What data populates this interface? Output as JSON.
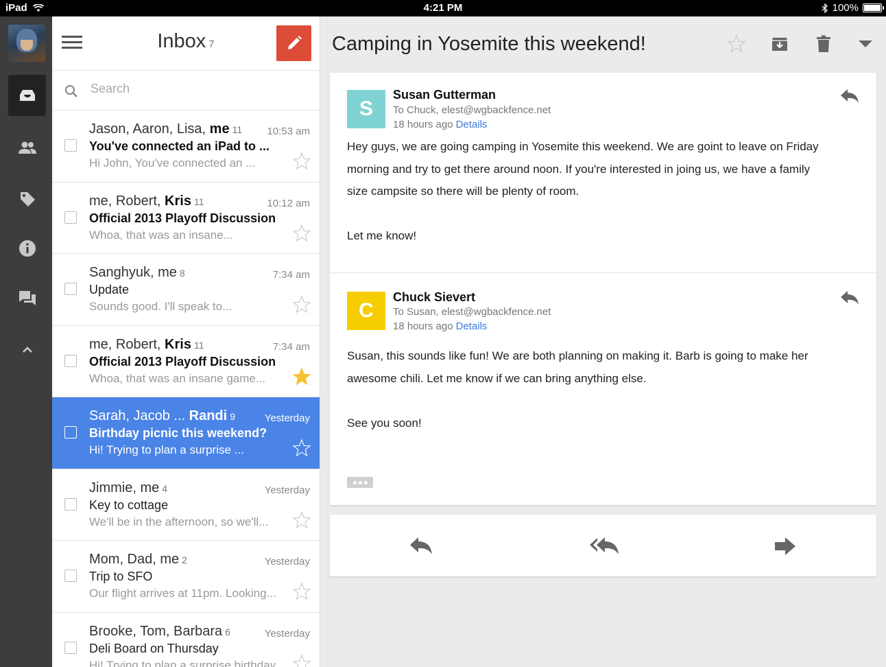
{
  "status_bar": {
    "device": "iPad",
    "time": "4:21 PM",
    "battery": "100%",
    "battery_level": 1.0
  },
  "rail": {
    "items": [
      "inbox-tray-icon",
      "people-icon",
      "label-icon",
      "info-icon",
      "chat-icon",
      "chevron-up-icon"
    ]
  },
  "inbox": {
    "title": "Inbox",
    "unread_count": "7",
    "search_placeholder": "Search",
    "threads": [
      {
        "from_plain": "Jason, Aaron, Lisa, ",
        "from_bold": "me",
        "count": "11",
        "time": "10:53 am",
        "subject": "You've connected an iPad to ...",
        "subject_bold": true,
        "snippet": "Hi John, You've connected an ...",
        "starred": false,
        "selected": false
      },
      {
        "from_plain": "me, Robert, ",
        "from_bold": "Kris",
        "count": "11",
        "time": "10:12 am",
        "subject": "Official 2013 Playoff Discussion",
        "subject_bold": true,
        "snippet": "Whoa, that was an insane...",
        "starred": false,
        "selected": false
      },
      {
        "from_plain": "Sanghyuk, me",
        "from_bold": "",
        "count": "8",
        "time": "7:34 am",
        "subject": "Update",
        "subject_bold": false,
        "snippet": "Sounds good. I'll speak to...",
        "starred": false,
        "selected": false
      },
      {
        "from_plain": "me, Robert, ",
        "from_bold": "Kris",
        "count": "11",
        "time": "7:34 am",
        "subject": "Official 2013 Playoff Discussion",
        "subject_bold": true,
        "snippet": "Whoa, that was an insane game...",
        "starred": true,
        "selected": false
      },
      {
        "from_plain": "Sarah, Jacob ... ",
        "from_bold": "Randi",
        "count": "9",
        "time": "Yesterday",
        "subject": "Birthday picnic this weekend?",
        "subject_bold": true,
        "snippet": "Hi! Trying to plan a surprise ...",
        "starred": false,
        "selected": true
      },
      {
        "from_plain": "Jimmie, me",
        "from_bold": "",
        "count": "4",
        "time": "Yesterday",
        "subject": "Key to cottage",
        "subject_bold": false,
        "snippet": "We'll be in the afternoon, so we'll...",
        "starred": false,
        "selected": false
      },
      {
        "from_plain": "Mom, Dad, me",
        "from_bold": "",
        "count": "2",
        "time": "Yesterday",
        "subject": "Trip to SFO",
        "subject_bold": false,
        "snippet": "Our flight arrives at 11pm. Looking...",
        "starred": false,
        "selected": false
      },
      {
        "from_plain": "Brooke, Tom, Barbara",
        "from_bold": "",
        "count": "6",
        "time": "Yesterday",
        "subject": "Deli Board on Thursday",
        "subject_bold": false,
        "snippet": "Hi! Trying to plan a surprise birthday...",
        "starred": false,
        "selected": false
      }
    ]
  },
  "reader": {
    "thread_title": "Camping in Yosemite this weekend!",
    "messages": [
      {
        "avatar_letter": "S",
        "avatar_color": "#7fd3d3",
        "sender": "Susan Gutterman",
        "to": "To Chuck, elest@wgbackfence.net",
        "time": "18 hours ago",
        "details": "Details",
        "body_lines": [
          "Hey guys, we are going camping in Yosemite this weekend. We are goint to leave on Friday",
          "morning and try to get there around noon. If you're interested in joing us, we have a family",
          "size campsite so there will be plenty of room.",
          "",
          "Let me know!"
        ]
      },
      {
        "avatar_letter": "C",
        "avatar_color": "#f6cd00",
        "sender": "Chuck Sievert",
        "to": "To Susan, elest@wgbackfence.net",
        "time": "18 hours ago",
        "details": "Details",
        "body_lines": [
          "Susan, this sounds like fun! We are both planning on making it. Barb is going to make her",
          "awesome chili. Let me know if we can bring anything else.",
          "",
          "See you soon!"
        ]
      }
    ]
  },
  "colors": {
    "compose": "#dd4b39",
    "selected_row": "#4a84e6",
    "link": "#3b7bd9",
    "star_filled": "#f4c430"
  }
}
